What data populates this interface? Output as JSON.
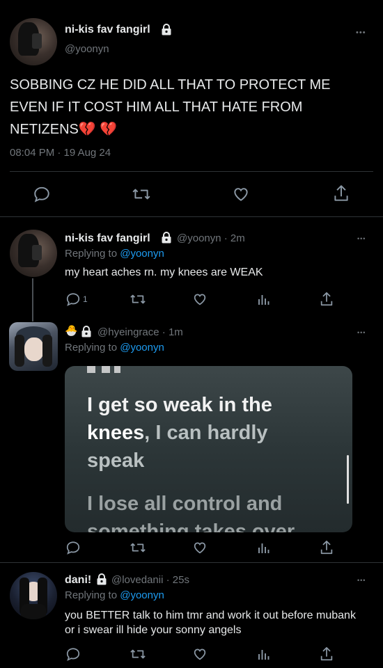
{
  "main_tweet": {
    "display_name": "ni-kis fav fangirl",
    "handle": "@yoonyn",
    "text": "SOBBING CZ HE DID ALL THAT TO PROTECT ME EVEN IF IT COST HIM ALL THAT HATE FROM NETIZENS💔 💔",
    "timestamp": "08:04 PM · 19 Aug 24",
    "more": "•••"
  },
  "replies": [
    {
      "display_name": "ni-kis fav fangirl",
      "handle": "@yoonyn · 2m",
      "replying_label": "Replying to",
      "replying_to": "@yoonyn",
      "text": "my heart aches rn. my knees are WEAK",
      "reply_count": "1",
      "more": "•••"
    },
    {
      "display_name": "🐣",
      "handle": "@hyeingrace · 1m",
      "replying_label": "Replying to",
      "replying_to": "@yoonyn",
      "media_lines": [
        "I get so weak in the",
        "knees, I can hardly",
        "speak",
        "I lose all control and",
        "something takes over"
      ],
      "more": "•••"
    },
    {
      "display_name": "dani!",
      "handle": "@lovedanii · 25s",
      "replying_label": "Replying to",
      "replying_to": "@yoonyn",
      "text": "you BETTER talk to him tmr and work it out before mubank or i swear ill hide your sonny angels",
      "more": "•••"
    }
  ],
  "colors": {
    "background": "#000000",
    "link": "#1d9bf0",
    "muted": "#71767b",
    "divider": "#2f3336"
  }
}
